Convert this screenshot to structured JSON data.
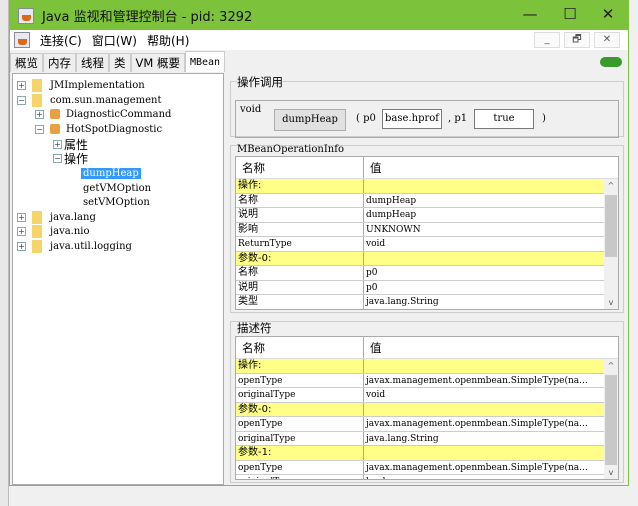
{
  "window": {
    "title": "Java 监视和管理控制台 - pid: 3292",
    "minimize": "—",
    "maximize": "☐",
    "close": "✕"
  },
  "menu": [
    "连接(C)",
    "窗口(W)",
    "帮助(H)"
  ],
  "mdi": {
    "min": "_",
    "restore": "🗗",
    "close": "✕"
  },
  "tabs": [
    "概览",
    "内存",
    "线程",
    "类",
    "VM 概要",
    "MBean"
  ],
  "tree": [
    {
      "label": "JMImplementation",
      "pm": "+"
    },
    {
      "label": "com.sun.management",
      "pm": "−"
    },
    {
      "label": "DiagnosticCommand",
      "pm": "+"
    },
    {
      "label": "HotSpotDiagnostic",
      "pm": "−"
    },
    {
      "label": "属性",
      "pm": "+"
    },
    {
      "label": "操作",
      "pm": "−"
    },
    {
      "label": "dumpHeap"
    },
    {
      "label": "getVMOption"
    },
    {
      "label": "setVMOption"
    },
    {
      "label": "java.lang",
      "pm": "+"
    },
    {
      "label": "java.nio",
      "pm": "+"
    },
    {
      "label": "java.util.logging",
      "pm": "+"
    }
  ],
  "invoke": {
    "group": "操作调用",
    "return_type": "void",
    "button": "dumpHeap",
    "open": "( p0",
    "p0": "base.hprof",
    "sep": ", p1",
    "p1": "true",
    "close": ")"
  },
  "opinfo": {
    "group": "MBeanOperationInfo",
    "headers": [
      "名称",
      "值"
    ],
    "rows": [
      [
        "操作:",
        ""
      ],
      [
        "名称",
        "dumpHeap"
      ],
      [
        "说明",
        "dumpHeap"
      ],
      [
        "影响",
        "UNKNOWN"
      ],
      [
        "ReturnType",
        "void"
      ],
      [
        "参数-0:",
        ""
      ],
      [
        "名称",
        "p0"
      ],
      [
        "说明",
        "p0"
      ],
      [
        "类型",
        "java.lang.String"
      ]
    ],
    "scroll": {
      "up": "^",
      "down": "v"
    }
  },
  "desc": {
    "group": "描述符",
    "headers": [
      "名称",
      "值"
    ],
    "rows": [
      [
        "操作:",
        ""
      ],
      [
        "openType",
        "javax.management.openmbean.SimpleType(na..."
      ],
      [
        "originalType",
        "void"
      ],
      [
        "参数-0:",
        ""
      ],
      [
        "openType",
        "javax.management.openmbean.SimpleType(na..."
      ],
      [
        "originalType",
        "java.lang.String"
      ],
      [
        "参数-1:",
        ""
      ],
      [
        "openType",
        "javax.management.openmbean.SimpleType(na..."
      ],
      [
        "originalType",
        "boolean"
      ]
    ],
    "scroll": {
      "up": "^",
      "down": "v"
    }
  },
  "colors": {
    "titlebar": "#7cc23a",
    "highlight_row": "#ffff88",
    "selection": "#3399ff"
  }
}
